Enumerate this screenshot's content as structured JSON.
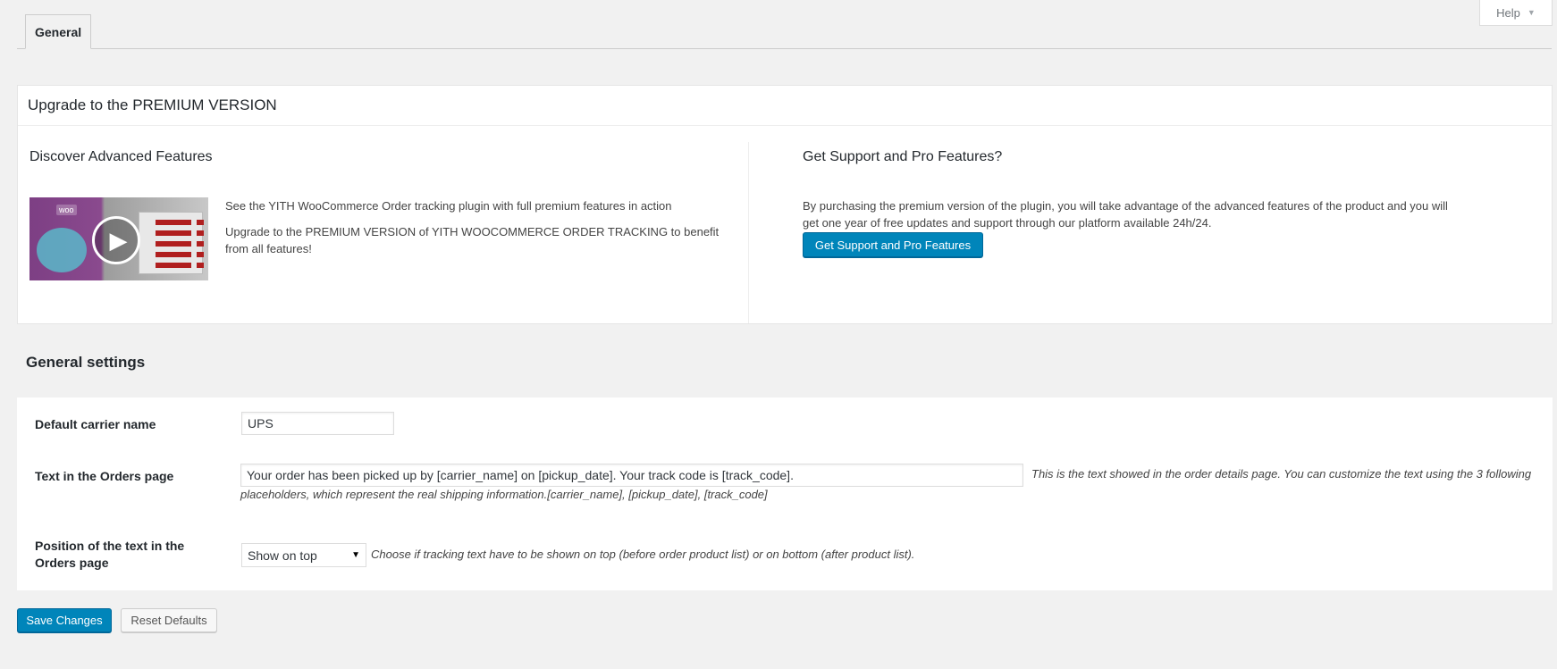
{
  "help": {
    "label": "Help",
    "caret": "▼"
  },
  "tabs": [
    {
      "label": "General"
    }
  ],
  "premium": {
    "title": "Upgrade to the PREMIUM VERSION",
    "left": {
      "heading": "Discover Advanced Features",
      "thumb_badge": "woo",
      "video_text": "See the YITH WooCommerce Order tracking plugin with full premium features in action",
      "upgrade_text": "Upgrade to the PREMIUM VERSION of YITH WOOCOMMERCE ORDER TRACKING to benefit from all features!"
    },
    "right": {
      "heading": "Get Support and Pro Features?",
      "text": "By purchasing the premium version of the plugin, you will take advantage of the advanced features of the product and you will get one year of free updates and support through our platform available 24h/24.",
      "button_label": "Get Support and Pro Features"
    }
  },
  "settings": {
    "heading": "General settings",
    "carrier": {
      "label": "Default carrier name",
      "value": "UPS"
    },
    "orders_text": {
      "label": "Text in the Orders page",
      "value": "Your order has been picked up by [carrier_name] on [pickup_date]. Your track code is [track_code].",
      "description": "This is the text showed in the order details page. You can customize the text using the 3 following placeholders, which represent the real shipping information.[carrier_name], [pickup_date], [track_code]"
    },
    "position": {
      "label": "Position of the text in the Orders page",
      "selected": "Show on top",
      "description": "Choose if tracking text have to be shown on top (before order product list) or on bottom (after product list)."
    }
  },
  "actions": {
    "save_label": "Save Changes",
    "reset_label": "Reset Defaults"
  },
  "colors": {
    "primary": "#0085ba",
    "background": "#f1f1f1"
  },
  "icons": {
    "play": "play-icon",
    "dropdown": "dropdown-arrow-icon"
  }
}
